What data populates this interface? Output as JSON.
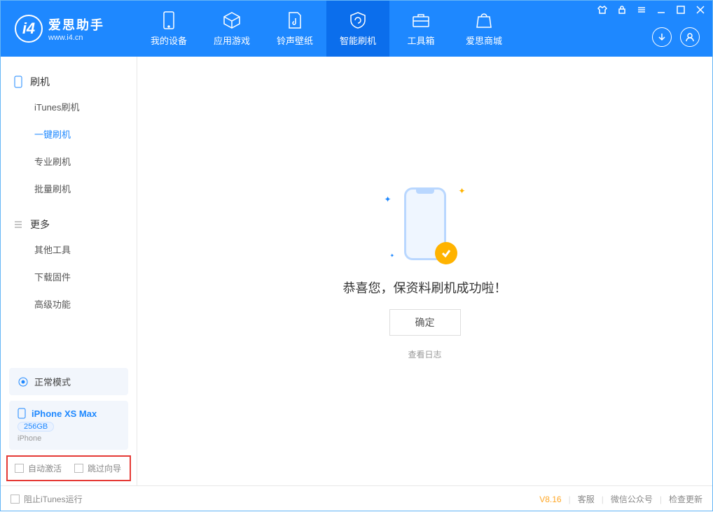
{
  "app": {
    "title": "爱思助手",
    "subtitle": "www.i4.cn"
  },
  "tabs": [
    {
      "label": "我的设备"
    },
    {
      "label": "应用游戏"
    },
    {
      "label": "铃声壁纸"
    },
    {
      "label": "智能刷机"
    },
    {
      "label": "工具箱"
    },
    {
      "label": "爱思商城"
    }
  ],
  "sidebar": {
    "section1": {
      "title": "刷机",
      "items": [
        "iTunes刷机",
        "一键刷机",
        "专业刷机",
        "批量刷机"
      ]
    },
    "section2": {
      "title": "更多",
      "items": [
        "其他工具",
        "下载固件",
        "高级功能"
      ]
    }
  },
  "mode": {
    "label": "正常模式"
  },
  "device": {
    "name": "iPhone XS Max",
    "storage": "256GB",
    "type": "iPhone"
  },
  "checkboxes": {
    "auto_activate": "自动激活",
    "skip_guide": "跳过向导"
  },
  "main": {
    "success_text": "恭喜您，保资料刷机成功啦！",
    "ok_button": "确定",
    "view_log": "查看日志"
  },
  "statusbar": {
    "block_itunes": "阻止iTunes运行",
    "version": "V8.16",
    "links": [
      "客服",
      "微信公众号",
      "检查更新"
    ]
  }
}
